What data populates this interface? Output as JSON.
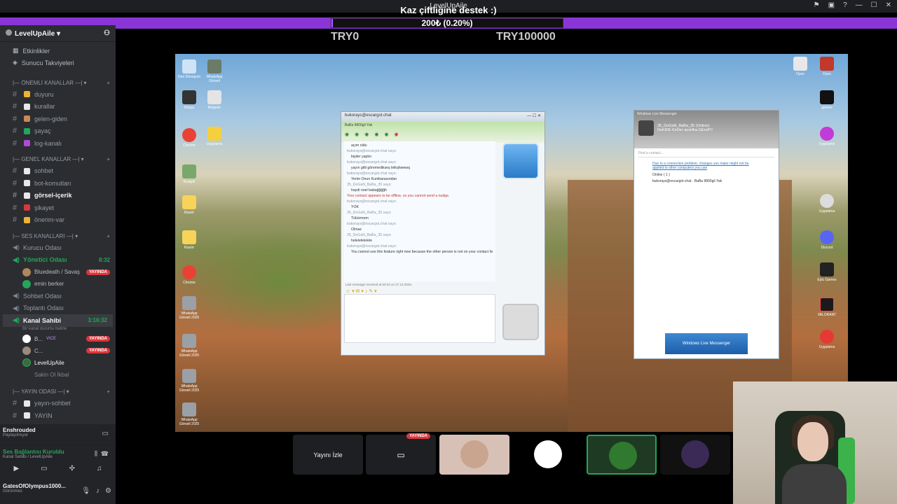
{
  "window": {
    "title": "LevelUpAile"
  },
  "donation": {
    "headline": "Kaz çiftliğine destek :)",
    "progress_label": "200₺ (0.20%)",
    "progress_fraction": 0.002,
    "goal_min": "TRY0",
    "goal_max": "TRY100000"
  },
  "sidebar": {
    "server_name": "LevelUpAile",
    "nav": [
      {
        "label": "Etkinlikler"
      },
      {
        "label": "Sunucu Takviyeleri"
      }
    ],
    "categories": {
      "important": "ÖNEMLİ KANALLAR",
      "general": "GENEL KANALLAR",
      "voice": "SES KANALLARI",
      "stream": "YAYIN ODASI"
    },
    "important_channels": [
      {
        "label": "duyuru",
        "color": "#f0b232"
      },
      {
        "label": "kurallar",
        "color": "#e8e8e8"
      },
      {
        "label": "gelen-giden",
        "color": "#c98a5a"
      },
      {
        "label": "şayaç",
        "color": "#23a55a"
      },
      {
        "label": "log-kanalı",
        "color": "#b04bd8"
      }
    ],
    "general_channels": [
      {
        "label": "sohbet",
        "color": "#e8e8e8"
      },
      {
        "label": "bot-komutları",
        "color": "#e8e8e8"
      },
      {
        "label": "görsel-içerik",
        "color": "#e8e8e8"
      },
      {
        "label": "şikayet",
        "color": "#da373c"
      },
      {
        "label": "önerim-var",
        "color": "#f0b232"
      }
    ],
    "voice_channels": {
      "kurucu": "Kurucu Odası",
      "yonetici": "Yönetici Odası",
      "yonetici_time": "8:32",
      "yonetici_users": [
        {
          "name": "Bluedeath / Savaş",
          "live": "YAYINDA"
        },
        {
          "name": "emin berker"
        }
      ],
      "sohbet": "Sohbet Odası",
      "toplanti": "Toplantı Odası",
      "kanal_sahibi": "Kanal Sahibi",
      "kanal_sahibi_time": "3:16:32",
      "kanal_sahibi_sub": "Bir kanal durumu belirle",
      "kanal_users": [
        {
          "name": "B...",
          "extra": "VICE",
          "live": "YAYINDA"
        },
        {
          "name": "C...",
          "live": "YAYINDA"
        },
        {
          "name": "LevelUpAile"
        },
        {
          "name": "Sakin Ol İkbal"
        }
      ]
    },
    "stream_channels": [
      {
        "label": "yayın-sohbet"
      },
      {
        "label": "YAYIN"
      }
    ],
    "activity": {
      "game": "Enshrouded",
      "status": "Paylaşılmıyor"
    },
    "voice_status": {
      "connected": "Ses Bağlantısı Kuruldu",
      "where": "Kanal Sahibi / LevelUpAile"
    },
    "user": {
      "name": "GatesOfOlympus1000...",
      "status": "Görünmez"
    }
  },
  "desktop": {
    "icons_left": [
      "Geri Dönüşüm",
      "WhatsApp Görseli",
      "Dosya",
      "Belgeler",
      "Chrome",
      "Uygulama",
      "Kısayol",
      "Klasör",
      "Klasör",
      "Chrome",
      "WhatsApp Görseli 2025",
      "WhatsApp Görseli 2025",
      "WhatsApp Görseli 2025",
      "WhatsApp Görseli 2025",
      "WhatsApp Görseli 2025"
    ],
    "icons_right": [
      "Oyun",
      "Oyun",
      "games",
      "Uygulama",
      "Uygulama",
      "Discord",
      "Epic Games",
      "VALORANT",
      "Uygulama"
    ]
  },
  "msn_chat": {
    "title": "bukorays@escargot.chat",
    "subtitle": "BaBa 9800gil Yak",
    "messages": [
      {
        "type": "text",
        "text": "açım oldu"
      },
      {
        "type": "sender",
        "text": "bukorays@escargot.chat says:"
      },
      {
        "type": "text",
        "text": "bişiler yaptın"
      },
      {
        "type": "sender",
        "text": "bukorays@escargot.chat says:"
      },
      {
        "type": "text",
        "text": "yayın gitti göremedikseş lelkqhwewq"
      },
      {
        "type": "sender",
        "text": "bukorays@escargot.chat says:"
      },
      {
        "type": "text",
        "text": "Yerim Onun Kumbarasından"
      },
      {
        "type": "sender",
        "text": "35_DoGaN_BaBa_35 says:"
      },
      {
        "type": "text",
        "text": "haydi noel babağğğğh"
      },
      {
        "type": "warn",
        "text": "Your contact appears to be offline, so you cannot send a nudge."
      },
      {
        "type": "sender",
        "text": "bukorays@escargot.chat says:"
      },
      {
        "type": "text",
        "text": "YOK"
      },
      {
        "type": "sender",
        "text": "35_DoGaN_BaBa_35 says:"
      },
      {
        "type": "text",
        "text": "Tükürmem"
      },
      {
        "type": "sender",
        "text": "bukorays@escargot.chat says:"
      },
      {
        "type": "text",
        "text": "Olmaz"
      },
      {
        "type": "sender",
        "text": "35_DoGaN_BaBa_35 says:"
      },
      {
        "type": "text",
        "text": "helelelelelele"
      },
      {
        "type": "sender",
        "text": "bukorays@escargot.chat says:"
      },
      {
        "type": "text",
        "text": "You cannot use this feature right now because the other person is not on your contact list"
      }
    ],
    "last_message": "Last message received at 00:23 on 27.12.2025."
  },
  "msn_contacts": {
    "title": "Windows Live Messenger",
    "user": "35_DoGaN_BaBa_35",
    "presence": "(Online)",
    "status_msg": "DeKiDE KeDer ausHha GEnd!!!!",
    "find_placeholder": "Find a contact...",
    "notice": "Due to a connection problem, changes you make might not be applied to other computers you use",
    "group": "Online ( 1 )",
    "contact": "bukorays@escargot.chat - BaBa 9800gil Yak",
    "banner": "Windows Live Messenger"
  },
  "participants": {
    "watch_label": "Yayını İzle",
    "live_tag": "YAYINDA"
  },
  "colors": {
    "discord_bg": "#2b2d31",
    "discord_green": "#23a55a",
    "live_red": "#da373c",
    "banner_purple": "#8a35d8"
  }
}
